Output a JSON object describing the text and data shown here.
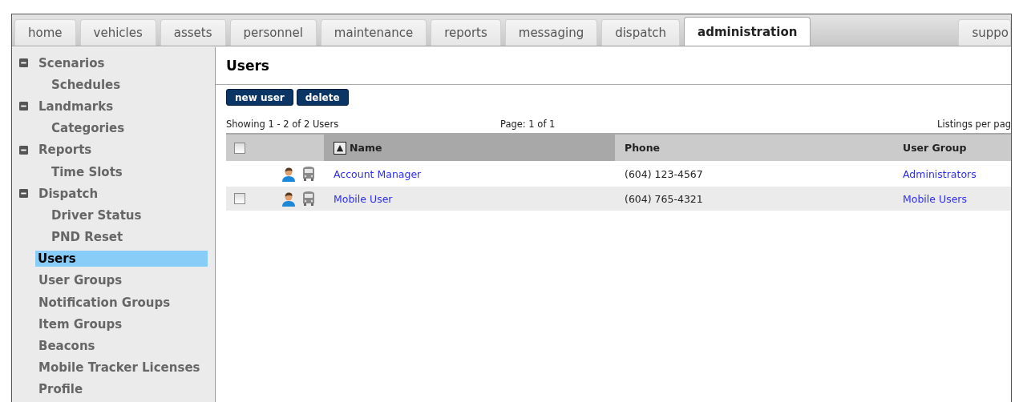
{
  "tabs": [
    {
      "label": "home",
      "selected": false
    },
    {
      "label": "vehicles",
      "selected": false
    },
    {
      "label": "assets",
      "selected": false
    },
    {
      "label": "personnel",
      "selected": false
    },
    {
      "label": "maintenance",
      "selected": false
    },
    {
      "label": "reports",
      "selected": false
    },
    {
      "label": "messaging",
      "selected": false
    },
    {
      "label": "dispatch",
      "selected": false
    },
    {
      "label": "administration",
      "selected": true
    }
  ],
  "tabs_right": [
    {
      "label": "suppo",
      "selected": false
    }
  ],
  "sidebar": {
    "items": [
      {
        "label": "Scenarios",
        "expanded": true,
        "selected": false,
        "children": [
          {
            "label": "Schedules",
            "selected": false
          }
        ]
      },
      {
        "label": "Landmarks",
        "expanded": true,
        "selected": false,
        "children": [
          {
            "label": "Categories",
            "selected": false
          }
        ]
      },
      {
        "label": "Reports",
        "expanded": true,
        "selected": false,
        "children": [
          {
            "label": "Time Slots",
            "selected": false
          }
        ]
      },
      {
        "label": "Dispatch",
        "expanded": true,
        "selected": false,
        "children": [
          {
            "label": "Driver Status",
            "selected": false
          },
          {
            "label": "PND Reset",
            "selected": false
          }
        ]
      },
      {
        "label": "Users",
        "selected": true
      },
      {
        "label": "User Groups",
        "selected": false
      },
      {
        "label": "Notification Groups",
        "selected": false
      },
      {
        "label": "Item Groups",
        "selected": false
      },
      {
        "label": "Beacons",
        "selected": false
      },
      {
        "label": "Mobile Tracker Licenses",
        "selected": false
      },
      {
        "label": "Profile",
        "selected": false
      }
    ]
  },
  "page": {
    "title": "Users",
    "buttons": [
      "new user",
      "delete"
    ],
    "showing": "Showing 1 - 2 of 2 Users",
    "pager": "Page: 1 of 1",
    "listings": "Listings per pag",
    "table": {
      "header_checked": false,
      "columns": [
        {
          "label": "Name",
          "sorted": true,
          "sort_icon": "▲"
        },
        {
          "label": "Phone",
          "sorted": false
        },
        {
          "label": "User Group",
          "sorted": false
        }
      ],
      "rows": [
        {
          "checkable": false,
          "name": "Account Manager",
          "phone": "(604) 123-4567",
          "group": "Administrators"
        },
        {
          "checkable": true,
          "checked": false,
          "name": "Mobile User",
          "phone": "(604) 765-4321",
          "group": "Mobile Users"
        }
      ]
    }
  }
}
